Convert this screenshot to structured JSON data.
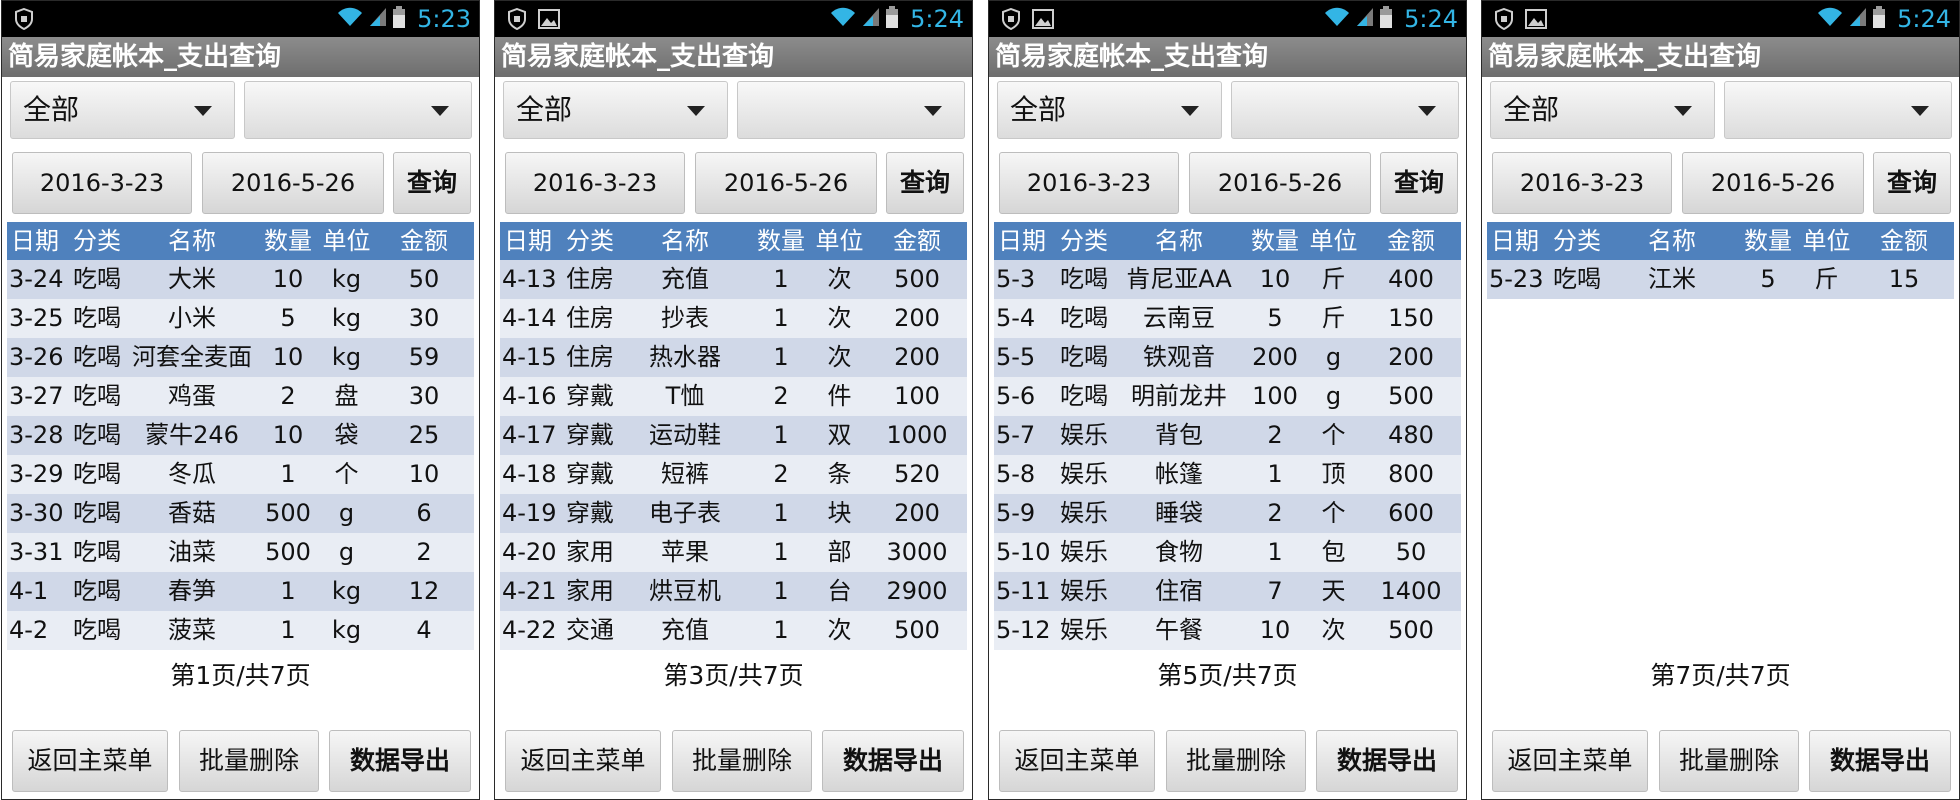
{
  "screens": [
    {
      "status_time": "5:23",
      "title": "简易家庭帐本_支出查询",
      "category_select": "全部",
      "sub_select": "",
      "start_date": "2016-3-23",
      "end_date": "2016-5-26",
      "query_label": "查询",
      "columns": [
        "日期",
        "分类",
        "名称",
        "数量",
        "单位",
        "金额"
      ],
      "rows": [
        [
          "3-24",
          "吃喝",
          "大米",
          "10",
          "kg",
          "50"
        ],
        [
          "3-25",
          "吃喝",
          "小米",
          "5",
          "kg",
          "30"
        ],
        [
          "3-26",
          "吃喝",
          "河套全麦面",
          "10",
          "kg",
          "59"
        ],
        [
          "3-27",
          "吃喝",
          "鸡蛋",
          "2",
          "盘",
          "30"
        ],
        [
          "3-28",
          "吃喝",
          "蒙牛246",
          "10",
          "袋",
          "25"
        ],
        [
          "3-29",
          "吃喝",
          "冬瓜",
          "1",
          "个",
          "10"
        ],
        [
          "3-30",
          "吃喝",
          "香菇",
          "500",
          "g",
          "6"
        ],
        [
          "3-31",
          "吃喝",
          "油菜",
          "500",
          "g",
          "2"
        ],
        [
          "4-1",
          "吃喝",
          "春笋",
          "1",
          "kg",
          "12"
        ],
        [
          "4-2",
          "吃喝",
          "菠菜",
          "1",
          "kg",
          "4"
        ]
      ],
      "page_text": "第1页/共7页",
      "back_label": "返回主菜单",
      "batch_delete_label": "批量删除",
      "export_label": "数据导出"
    },
    {
      "status_time": "5:24",
      "title": "简易家庭帐本_支出查询",
      "category_select": "全部",
      "sub_select": "",
      "start_date": "2016-3-23",
      "end_date": "2016-5-26",
      "query_label": "查询",
      "columns": [
        "日期",
        "分类",
        "名称",
        "数量",
        "单位",
        "金额"
      ],
      "rows": [
        [
          "4-13",
          "住房",
          "充值",
          "1",
          "次",
          "500"
        ],
        [
          "4-14",
          "住房",
          "抄表",
          "1",
          "次",
          "200"
        ],
        [
          "4-15",
          "住房",
          "热水器",
          "1",
          "次",
          "200"
        ],
        [
          "4-16",
          "穿戴",
          "T恤",
          "2",
          "件",
          "100"
        ],
        [
          "4-17",
          "穿戴",
          "运动鞋",
          "1",
          "双",
          "1000"
        ],
        [
          "4-18",
          "穿戴",
          "短裤",
          "2",
          "条",
          "520"
        ],
        [
          "4-19",
          "穿戴",
          "电子表",
          "1",
          "块",
          "200"
        ],
        [
          "4-20",
          "家用",
          "苹果",
          "1",
          "部",
          "3000"
        ],
        [
          "4-21",
          "家用",
          "烘豆机",
          "1",
          "台",
          "2900"
        ],
        [
          "4-22",
          "交通",
          "充值",
          "1",
          "次",
          "500"
        ]
      ],
      "page_text": "第3页/共7页",
      "back_label": "返回主菜单",
      "batch_delete_label": "批量删除",
      "export_label": "数据导出"
    },
    {
      "status_time": "5:24",
      "title": "简易家庭帐本_支出查询",
      "category_select": "全部",
      "sub_select": "",
      "start_date": "2016-3-23",
      "end_date": "2016-5-26",
      "query_label": "查询",
      "columns": [
        "日期",
        "分类",
        "名称",
        "数量",
        "单位",
        "金额"
      ],
      "rows": [
        [
          "5-3",
          "吃喝",
          "肯尼亚AA",
          "10",
          "斤",
          "400"
        ],
        [
          "5-4",
          "吃喝",
          "云南豆",
          "5",
          "斤",
          "150"
        ],
        [
          "5-5",
          "吃喝",
          "铁观音",
          "200",
          "g",
          "200"
        ],
        [
          "5-6",
          "吃喝",
          "明前龙井",
          "100",
          "g",
          "500"
        ],
        [
          "5-7",
          "娱乐",
          "背包",
          "2",
          "个",
          "480"
        ],
        [
          "5-8",
          "娱乐",
          "帐篷",
          "1",
          "顶",
          "800"
        ],
        [
          "5-9",
          "娱乐",
          "睡袋",
          "2",
          "个",
          "600"
        ],
        [
          "5-10",
          "娱乐",
          "食物",
          "1",
          "包",
          "50"
        ],
        [
          "5-11",
          "娱乐",
          "住宿",
          "7",
          "天",
          "1400"
        ],
        [
          "5-12",
          "娱乐",
          "午餐",
          "10",
          "次",
          "500"
        ]
      ],
      "page_text": "第5页/共7页",
      "back_label": "返回主菜单",
      "batch_delete_label": "批量删除",
      "export_label": "数据导出"
    },
    {
      "status_time": "5:24",
      "title": "简易家庭帐本_支出查询",
      "category_select": "全部",
      "sub_select": "",
      "start_date": "2016-3-23",
      "end_date": "2016-5-26",
      "query_label": "查询",
      "columns": [
        "日期",
        "分类",
        "名称",
        "数量",
        "单位",
        "金额"
      ],
      "rows": [
        [
          "5-23",
          "吃喝",
          "江米",
          "5",
          "斤",
          "15"
        ]
      ],
      "page_text": "第7页/共7页",
      "back_label": "返回主菜单",
      "batch_delete_label": "批量删除",
      "export_label": "数据导出"
    }
  ],
  "colors": {
    "status_time": "#33b5e5",
    "table_header": "#4f81bd",
    "row_dark": "#d0d8e8",
    "row_light": "#e9edf4"
  }
}
